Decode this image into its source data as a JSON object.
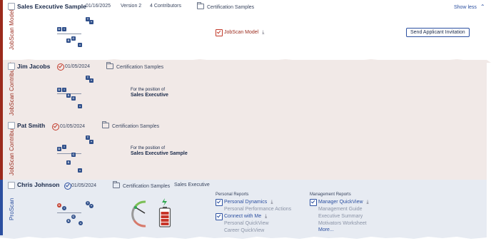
{
  "sec1": {
    "label": "JobScan Model",
    "name": "Sales Executive Sample",
    "date": "01/16/2025",
    "version": "Version 2",
    "contributors": "4 Contributors",
    "folder": "Certification Samples",
    "show_less": "Show less",
    "model_link": "JobScan Model",
    "send_button": "Send Applicant Invitation"
  },
  "sec2": {
    "label": "JobScan Contributor",
    "name": "Jim Jacobs",
    "date": "01/05/2024",
    "folder": "Certification Samples",
    "for_position": "For the position of",
    "position": "Sales Executive"
  },
  "sec3": {
    "label": "JobScan Contributor",
    "name": "Pat Smith",
    "date": "01/05/2024",
    "folder": "Certification Samples",
    "for_position": "For the position of",
    "position": "Sales Executive Sample"
  },
  "sec4": {
    "label": "ProScan",
    "name": "Chris Johnson",
    "date": "01/05/2024",
    "folder": "Certification Samples",
    "position": "Sales Executive",
    "personal_header": "Personal Reports",
    "personal": {
      "dynamics": "Personal Dynamics",
      "performance": "Personal Performance Actions",
      "connect": "Connect with Me",
      "quickview": "Personal QuickView",
      "career": "Career QuickView"
    },
    "management_header": "Management Reports",
    "management": {
      "manager_qv": "Manager QuickView",
      "guide": "Management Guide",
      "exec": "Executive Summary",
      "motivators": "Motivators Worksheet",
      "more": "More..."
    }
  },
  "disc_letters": [
    "D",
    "I",
    "S",
    "C"
  ],
  "icons": {
    "download": "download-icon",
    "folder": "folder-icon",
    "check": "check-icon",
    "chevron": "chevron-up-icon",
    "gauge": "gauge-icon",
    "battery": "battery-icon"
  },
  "colors": {
    "jobscan_accent": "#9b2a1c",
    "proscan_accent": "#2b4fa0",
    "contributor_bg": "#f1e9e7",
    "proscan_bg": "#e7ebf2"
  }
}
